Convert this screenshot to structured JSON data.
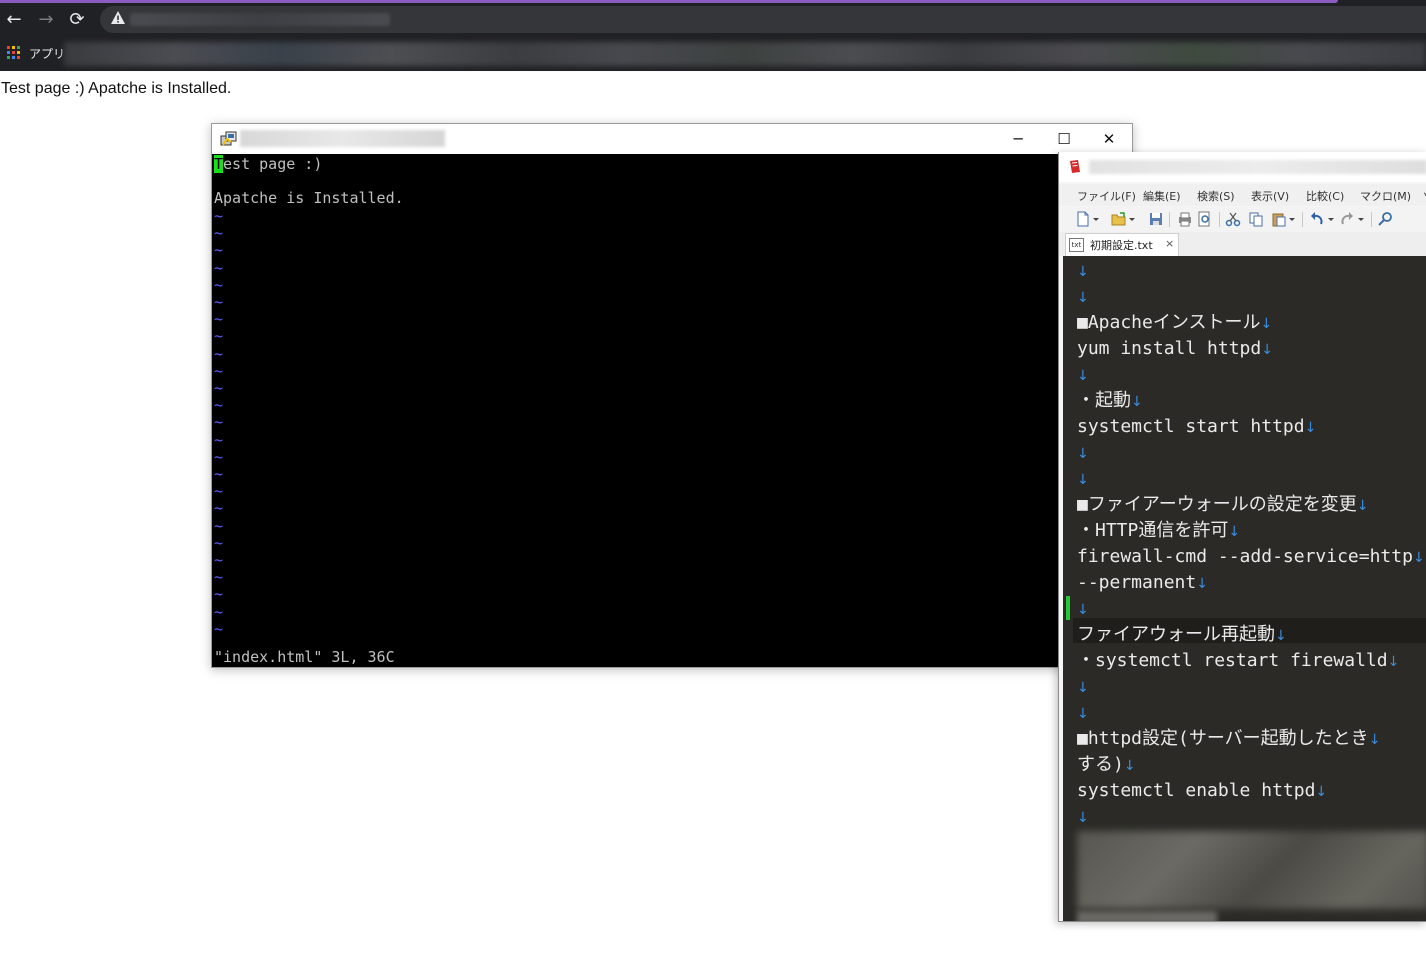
{
  "browser": {
    "nav": {
      "back_icon": "←",
      "forward_icon": "→",
      "reload_icon": "⟳"
    },
    "bookmarks": {
      "apps_label": "アプリ"
    },
    "accent_color": "#8a5cc0"
  },
  "page": {
    "content_text": "Test page :) Apatche is Installed."
  },
  "terminal": {
    "window_controls": {
      "minimize": "─",
      "maximize": "☐",
      "close": "✕"
    },
    "cursor_char": "T",
    "line1_rest": "est page :)",
    "line2": "Apatche is Installed.",
    "tilde": "~",
    "status": "\"index.html\" 3L, 36C"
  },
  "editor": {
    "menu": [
      "ファイル(F)",
      "編集(E)",
      "検索(S)",
      "表示(V)",
      "比較(C)",
      "マクロ(M)",
      "ツ"
    ],
    "tab": {
      "icon_text": "txt",
      "label": "初期設定.txt",
      "close": "×"
    },
    "eol_symbol": "↓",
    "lines": [
      "",
      "",
      "■Apacheインストール",
      "yum install httpd",
      "",
      "・起動",
      "systemctl start httpd",
      "",
      "",
      "■ファイアーウォールの設定を変更",
      "・HTTP通信を許可",
      "firewall-cmd --add-service=http",
      "--permanent",
      "",
      "ファイアウォール再起動",
      "・systemctl restart firewalld",
      "",
      "",
      "■httpd設定(サーバー起動したとき",
      "する)",
      "systemctl enable httpd",
      ""
    ]
  }
}
